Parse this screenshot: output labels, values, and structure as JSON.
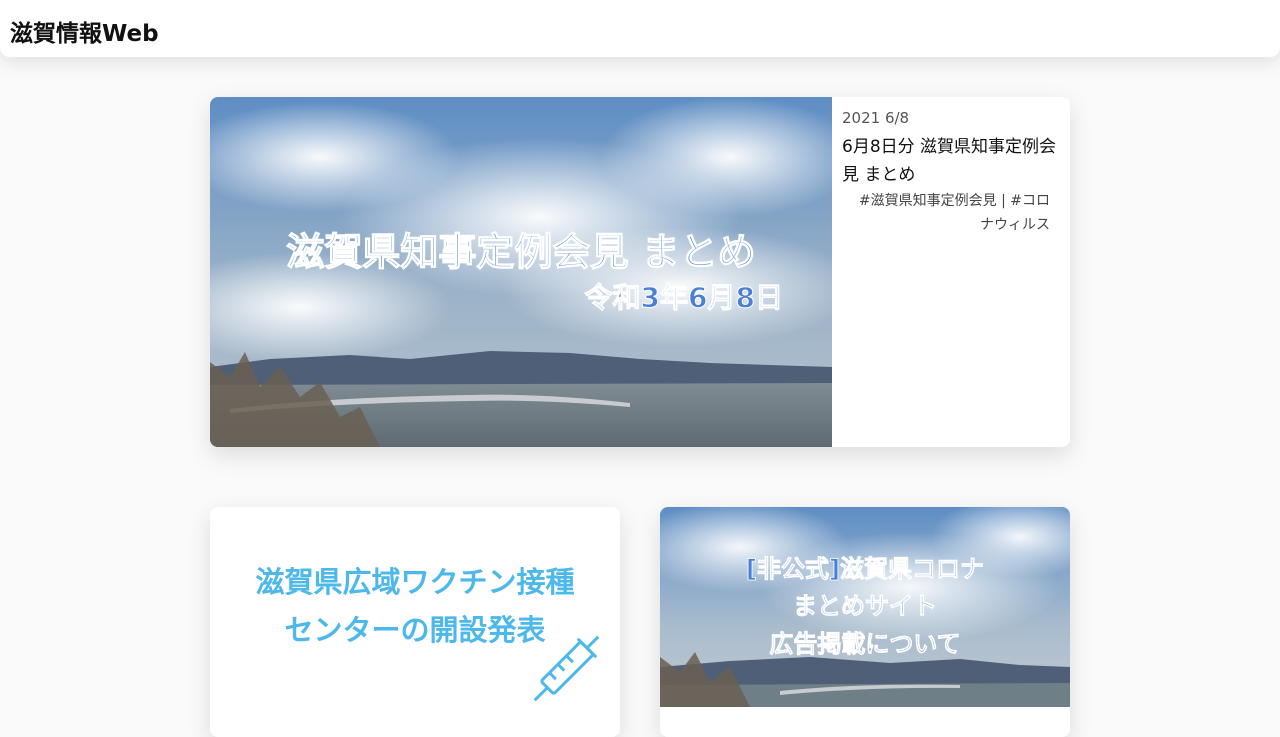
{
  "header": {
    "site_title": "滋賀情報Web"
  },
  "featured_post": {
    "image_text_main": "滋賀県知事定例会見 まとめ",
    "image_text_sub": "令和3年6月8日",
    "date": "2021 6/8",
    "title": "6月8日分 滋賀県知事定例会見 まとめ",
    "tags": "#滋賀県知事定例会見 | #コロナウィルス"
  },
  "cards": [
    {
      "image_text_line1": "滋賀県広域ワクチン接種",
      "image_text_line2": "センターの開設発表",
      "icon": "syringe-icon"
    },
    {
      "image_text_line1": "[非公式]滋賀県コロナ",
      "image_text_line2": "まとめサイト",
      "image_text_line3": "広告掲載について"
    }
  ],
  "colors": {
    "sky_top": "#5f8ec4",
    "text_blue": "#4a7fd6",
    "vaccine_blue": "#4db8ea",
    "water": "#6f7f88"
  }
}
